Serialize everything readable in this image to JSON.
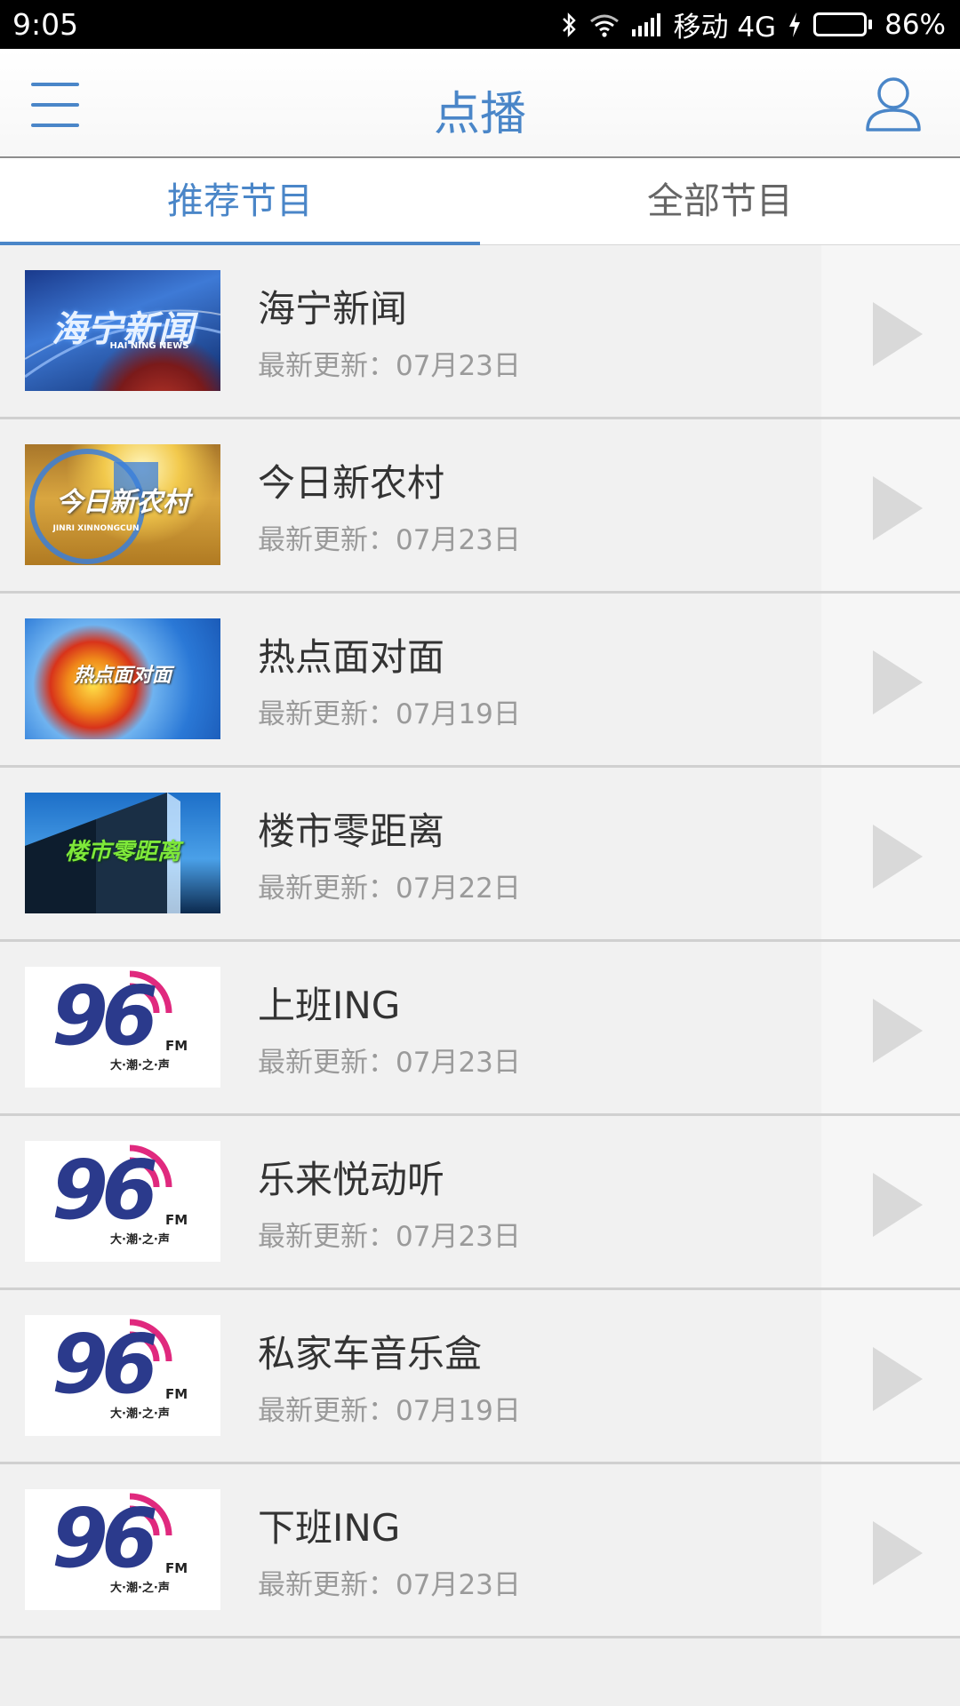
{
  "status_bar": {
    "time": "9:05",
    "carrier": "移动 4G",
    "battery": "86%",
    "battery_level": 0.86
  },
  "header": {
    "title": "点播",
    "menu_icon": "hamburger-menu-icon",
    "user_icon": "user-profile-icon"
  },
  "tabs": [
    {
      "label": "推荐节目",
      "active": true
    },
    {
      "label": "全部节目",
      "active": false
    }
  ],
  "programs": [
    {
      "title": "海宁新闻",
      "update": "最新更新：07月23日",
      "thumb_text": "海宁新闻",
      "thumb_sub": "HAI NING NEWS"
    },
    {
      "title": "今日新农村",
      "update": "最新更新：07月23日",
      "thumb_text": "今日新农村",
      "thumb_sub": "JINRI XINNONGCUN"
    },
    {
      "title": "热点面对面",
      "update": "最新更新：07月19日",
      "thumb_text": "热点面对面"
    },
    {
      "title": "楼市零距离",
      "update": "最新更新：07月22日",
      "thumb_text": "楼市零距离"
    },
    {
      "title": "上班ING",
      "update": "最新更新：07月23日",
      "thumb_text": "96",
      "thumb_fm": "FM",
      "thumb_sub": "大·潮·之·声"
    },
    {
      "title": "乐来悦动听",
      "update": "最新更新：07月23日",
      "thumb_text": "96",
      "thumb_fm": "FM",
      "thumb_sub": "大·潮·之·声"
    },
    {
      "title": "私家车音乐盒",
      "update": "最新更新：07月19日",
      "thumb_text": "96",
      "thumb_fm": "FM",
      "thumb_sub": "大·潮·之·声"
    },
    {
      "title": "下班ING",
      "update": "最新更新：07月23日",
      "thumb_text": "96",
      "thumb_fm": "FM",
      "thumb_sub": "大·潮·之·声"
    }
  ],
  "colors": {
    "accent": "#4a86c8",
    "battery_green": "#3bd12f"
  }
}
